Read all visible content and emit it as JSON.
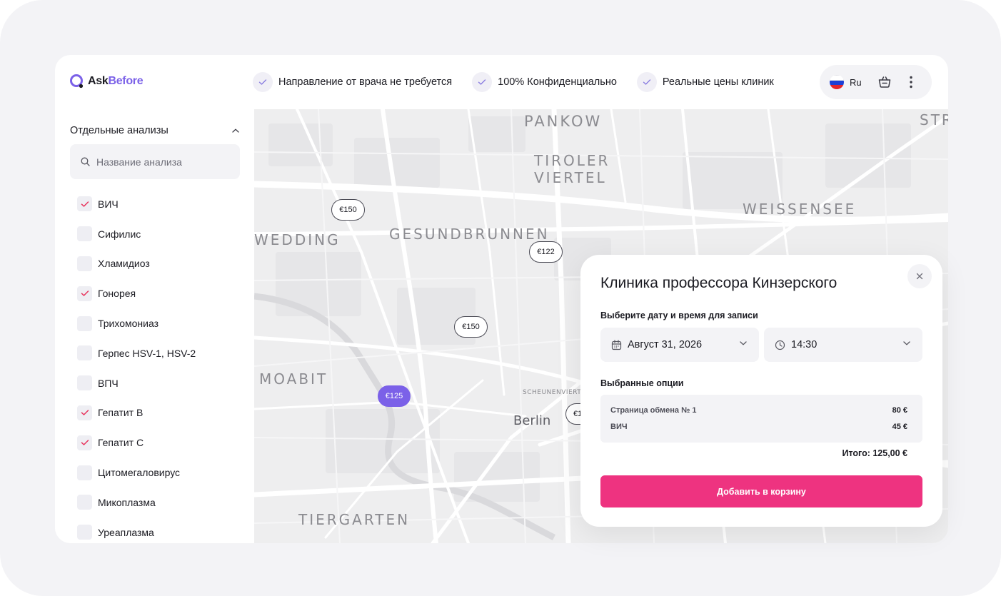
{
  "app": {
    "logo_ask": "Ask",
    "logo_before": "Before"
  },
  "header": {
    "features": [
      {
        "label": "Направление от врача не требуется"
      },
      {
        "label": "100% Конфиденциально"
      },
      {
        "label": "Реальные цены клиник"
      }
    ],
    "language": "Ru",
    "icons": [
      "flag-russia-icon",
      "basket-icon",
      "more-vertical-icon"
    ]
  },
  "sidebar": {
    "section_title": "Отдельные анализы",
    "search_placeholder": "Название анализа",
    "items": [
      {
        "label": "ВИЧ",
        "checked": true
      },
      {
        "label": "Сифилис",
        "checked": false
      },
      {
        "label": "Хламидиоз",
        "checked": false
      },
      {
        "label": "Гонорея",
        "checked": true
      },
      {
        "label": "Трихомониаз",
        "checked": false
      },
      {
        "label": "Герпес HSV-1, HSV-2",
        "checked": false
      },
      {
        "label": "ВПЧ",
        "checked": false
      },
      {
        "label": "Гепатит B",
        "checked": true
      },
      {
        "label": "Гепатит C",
        "checked": true
      },
      {
        "label": "Цитомегаловирус",
        "checked": false
      },
      {
        "label": "Микоплазма",
        "checked": false
      },
      {
        "label": "Уреаплазма",
        "checked": false
      }
    ]
  },
  "map": {
    "districts": [
      "PANKOW",
      "TIROLER",
      "VIERTEL",
      "WEISSENSEE",
      "GESUNDBRUNNEN",
      "WEDDING",
      "MOABIT",
      "TIERGARTEN",
      "STR"
    ],
    "city": "Berlin",
    "small_labels": [
      "SCHEUNENVIERT"
    ],
    "pins": [
      "€150",
      "€122",
      "€150",
      "€125",
      "€1"
    ],
    "active_pin": "€125"
  },
  "modal": {
    "title": "Клиника профессора Кинзерского",
    "datetime_label": "Выберите дату и время для записи",
    "date_value": "Август 31, 2026",
    "time_value": "14:30",
    "options_label": "Выбранные опции",
    "options": [
      {
        "name": "Страница обмена № 1",
        "price": "80 €"
      },
      {
        "name": "ВИЧ",
        "price": "45 €"
      }
    ],
    "total": "Итого: 125,00 €",
    "add_button": "Добавить в корзину"
  },
  "colors": {
    "accent_purple": "#7b61e8",
    "accent_pink": "#ee3380",
    "check_red": "#e8335c"
  }
}
